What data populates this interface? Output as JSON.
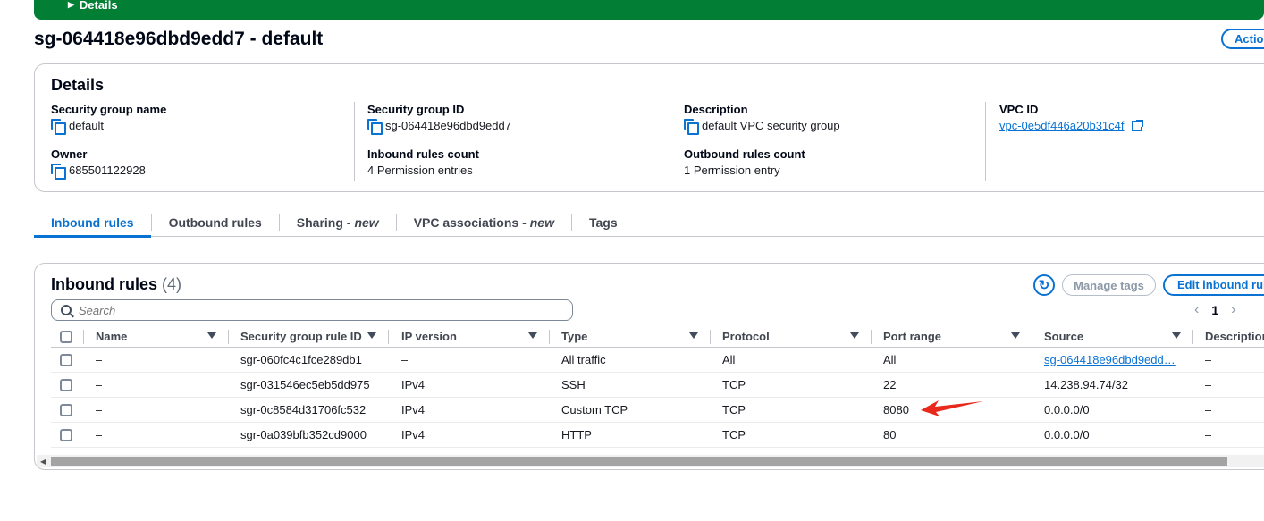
{
  "banner": {
    "label": "Details"
  },
  "page": {
    "title": "sg-064418e96dbd9edd7 - default",
    "actions_label": "Actio"
  },
  "details": {
    "heading": "Details",
    "fields": {
      "sg_name": {
        "label": "Security group name",
        "value": "default"
      },
      "sg_id": {
        "label": "Security group ID",
        "value": "sg-064418e96dbd9edd7"
      },
      "description": {
        "label": "Description",
        "value": "default VPC security group"
      },
      "vpc_id": {
        "label": "VPC ID",
        "value": "vpc-0e5df446a20b31c4f"
      },
      "owner": {
        "label": "Owner",
        "value": "685501122928"
      },
      "inbound_count": {
        "label": "Inbound rules count",
        "value": "4 Permission entries"
      },
      "outbound_count": {
        "label": "Outbound rules count",
        "value": "1 Permission entry"
      }
    }
  },
  "tabs": [
    {
      "label": "Inbound rules",
      "suffix": ""
    },
    {
      "label": "Outbound rules",
      "suffix": ""
    },
    {
      "label": "Sharing - ",
      "suffix": "new"
    },
    {
      "label": "VPC associations - ",
      "suffix": "new"
    },
    {
      "label": "Tags",
      "suffix": ""
    }
  ],
  "rules": {
    "heading": "Inbound rules",
    "count": "(4)",
    "manage_tags": "Manage tags",
    "edit_label": "Edit inbound rul",
    "search_placeholder": "Search",
    "page_number": "1",
    "columns": [
      "Name",
      "Security group rule ID",
      "IP version",
      "Type",
      "Protocol",
      "Port range",
      "Source",
      "Description"
    ],
    "rows": [
      {
        "name": "–",
        "rule_id": "sgr-060fc4c1fce289db1",
        "ip_version": "–",
        "type": "All traffic",
        "protocol": "All",
        "port_range": "All",
        "source": "sg-064418e96dbd9edd…",
        "description": "–"
      },
      {
        "name": "–",
        "rule_id": "sgr-031546ec5eb5dd975",
        "ip_version": "IPv4",
        "type": "SSH",
        "protocol": "TCP",
        "port_range": "22",
        "source": "14.238.94.74/32",
        "description": "–"
      },
      {
        "name": "–",
        "rule_id": "sgr-0c8584d31706fc532",
        "ip_version": "IPv4",
        "type": "Custom TCP",
        "protocol": "TCP",
        "port_range": "8080",
        "source": "0.0.0.0/0",
        "description": "–"
      },
      {
        "name": "–",
        "rule_id": "sgr-0a039bfb352cd9000",
        "ip_version": "IPv4",
        "type": "HTTP",
        "protocol": "TCP",
        "port_range": "80",
        "source": "0.0.0.0/0",
        "description": "–"
      }
    ]
  },
  "colors": {
    "accent": "#0972d3",
    "banner": "#037f35",
    "annotation": "#e8291c"
  },
  "icons": [
    "caret-right-icon",
    "copy-icon",
    "external-link-icon",
    "refresh-icon",
    "search-icon",
    "sort-icon",
    "chevron-left-icon",
    "chevron-right-icon",
    "red-arrow-annotation"
  ]
}
